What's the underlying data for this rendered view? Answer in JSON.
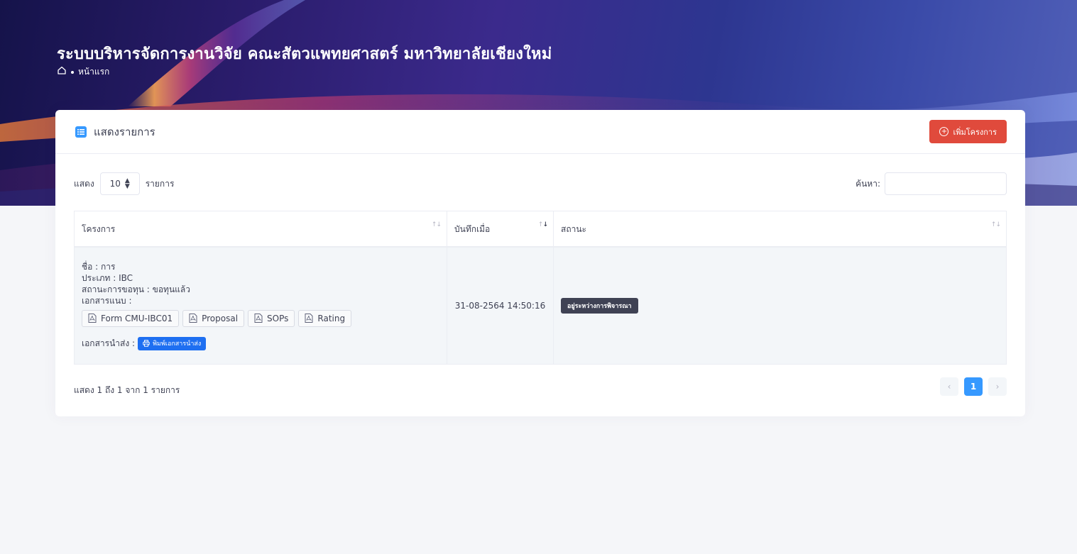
{
  "header": {
    "title": "ระบบบริหารจัดการงานวิจัย คณะสัตวแพทยศาสตร์ มหาวิทยาลัยเชียงใหม่",
    "breadcrumb_home": "หน้าแรก"
  },
  "card": {
    "title": "แสดงรายการ",
    "add_label": "เพิ่มโครงการ"
  },
  "controls": {
    "show_label": "แสดง",
    "page_length": "10",
    "entries_label": "รายการ",
    "search_label": "ค้นหา:",
    "search_value": ""
  },
  "table": {
    "columns": [
      "โครงการ",
      "บันทึกเมื่อ",
      "สถานะ"
    ],
    "rows": [
      {
        "name": "ชื่อ : การ",
        "type": "ประเภท : IBC",
        "funding": "สถานะการขอทุน : ขอทุนแล้ว",
        "attachments_label": "เอกสารแนบ :",
        "attachments": [
          "Form CMU-IBC01",
          "Proposal",
          "SOPs",
          "Rating"
        ],
        "send_label": "เอกสารนำส่ง :",
        "print_label": "พิมพ์เอกสารนำส่ง",
        "saved_at": "31-08-2564 14:50:16",
        "status": "อยู่ระหว่างการพิจารณา"
      }
    ]
  },
  "footer": {
    "info": "แสดง 1 ถึง 1 จาก 1 รายการ",
    "prev": "‹",
    "page": "1",
    "next": "›"
  },
  "colors": {
    "primary": "#3699ff",
    "danger": "#e04a3c",
    "print": "#1e6ff1",
    "badge": "#3f4254"
  }
}
